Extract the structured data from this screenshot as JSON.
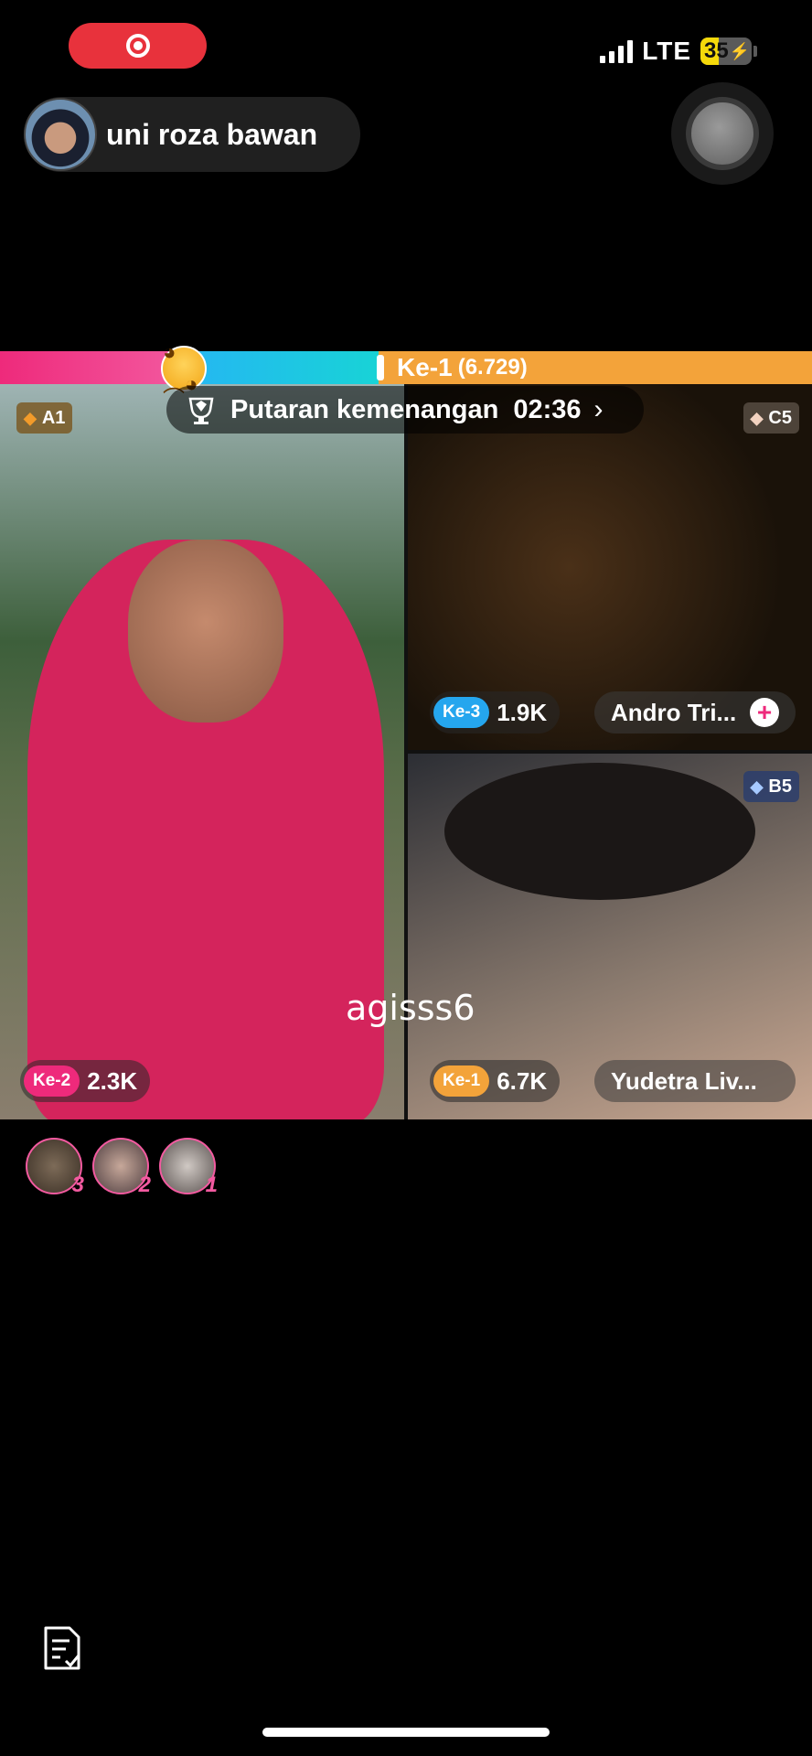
{
  "status_bar": {
    "network": "LTE",
    "battery": "35",
    "battery_level": 0.35
  },
  "host": {
    "name": "uni roza bawan"
  },
  "score_bar": {
    "rank_label": "Ke-1",
    "rank_score": "(6.729)"
  },
  "round": {
    "label": "Putaran kemenangan",
    "time": "02:36"
  },
  "tiles": {
    "left": {
      "tier": "A1",
      "rank": "Ke-2",
      "score": "2.3K"
    },
    "right_top": {
      "tier": "C5",
      "rank": "Ke-3",
      "score": "1.9K",
      "name": "Andro Tri..."
    },
    "right_bottom": {
      "tier": "B5",
      "rank": "Ke-1",
      "score": "6.7K",
      "name": "Yudetra Liv..."
    }
  },
  "watermark": "agisss6",
  "gifters": [
    {
      "rank": "3"
    },
    {
      "rank": "2"
    },
    {
      "rank": "1"
    }
  ],
  "icons": {
    "record": "record-icon",
    "trophy": "trophy-icon",
    "notes": "notes-check-icon"
  }
}
